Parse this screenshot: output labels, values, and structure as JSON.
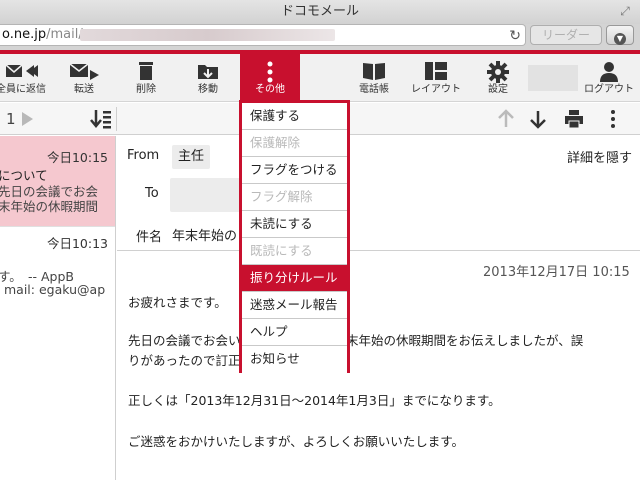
{
  "window": {
    "title": "ドコモメール",
    "resize_icon": "resize-icon"
  },
  "address_bar": {
    "url_host": "o.ne.jp",
    "url_path": "/mail/",
    "reload_icon": "reload-icon",
    "reader_label": "リーダー",
    "download_icon": "download-icon"
  },
  "toolbar": {
    "reply_all": "全員に返信",
    "forward": "転送",
    "delete": "削除",
    "move": "移動",
    "more": "その他",
    "contacts": "電話帳",
    "layout": "レイアウト",
    "settings": "設定",
    "logout": "ログアウト"
  },
  "subbar": {
    "page": "1"
  },
  "mail_list": [
    {
      "date": "今日10:15",
      "lines": [
        "について",
        "先日の会議でお会",
        "末年始の休暇期間"
      ],
      "selected": true
    },
    {
      "date": "今日10:13",
      "lines": [
        "す。　-- AppB",
        "mail: egaku@ap"
      ],
      "selected": false
    }
  ],
  "mail": {
    "from_label": "From",
    "from_value": "主任",
    "to_label": "To",
    "subject_label": "件名",
    "subject_value": "年末年始の",
    "details_link": "詳細を隠す",
    "timestamp": "2013年12月17日 10:15",
    "body": {
      "line1": "お疲れさまです。",
      "line2a": "先日の会議でお会い",
      "line2b": "末年始の休暇期間をお伝えしましたが、誤",
      "line3a": "りがあったので訂正",
      "line4": "正しくは「2013年12月31日〜2014年1月3日」までになります。",
      "line5": "ご迷惑をおかけいたしますが、よろしくお願いいたします。"
    }
  },
  "dropdown": [
    {
      "label": "保護する",
      "state": "enabled"
    },
    {
      "label": "保護解除",
      "state": "disabled"
    },
    {
      "label": "フラグをつける",
      "state": "enabled"
    },
    {
      "label": "フラグ解除",
      "state": "disabled"
    },
    {
      "label": "未読にする",
      "state": "enabled"
    },
    {
      "label": "既読にする",
      "state": "disabled"
    },
    {
      "label": "振り分けルール",
      "state": "highlighted"
    },
    {
      "label": "迷惑メール報告",
      "state": "enabled"
    },
    {
      "label": "ヘルプ",
      "state": "enabled"
    },
    {
      "label": "お知らせ",
      "state": "enabled"
    }
  ],
  "colors": {
    "brand": "#c8102e",
    "selected_row": "#f5c8cf",
    "disabled_text": "#b9b9b9"
  }
}
